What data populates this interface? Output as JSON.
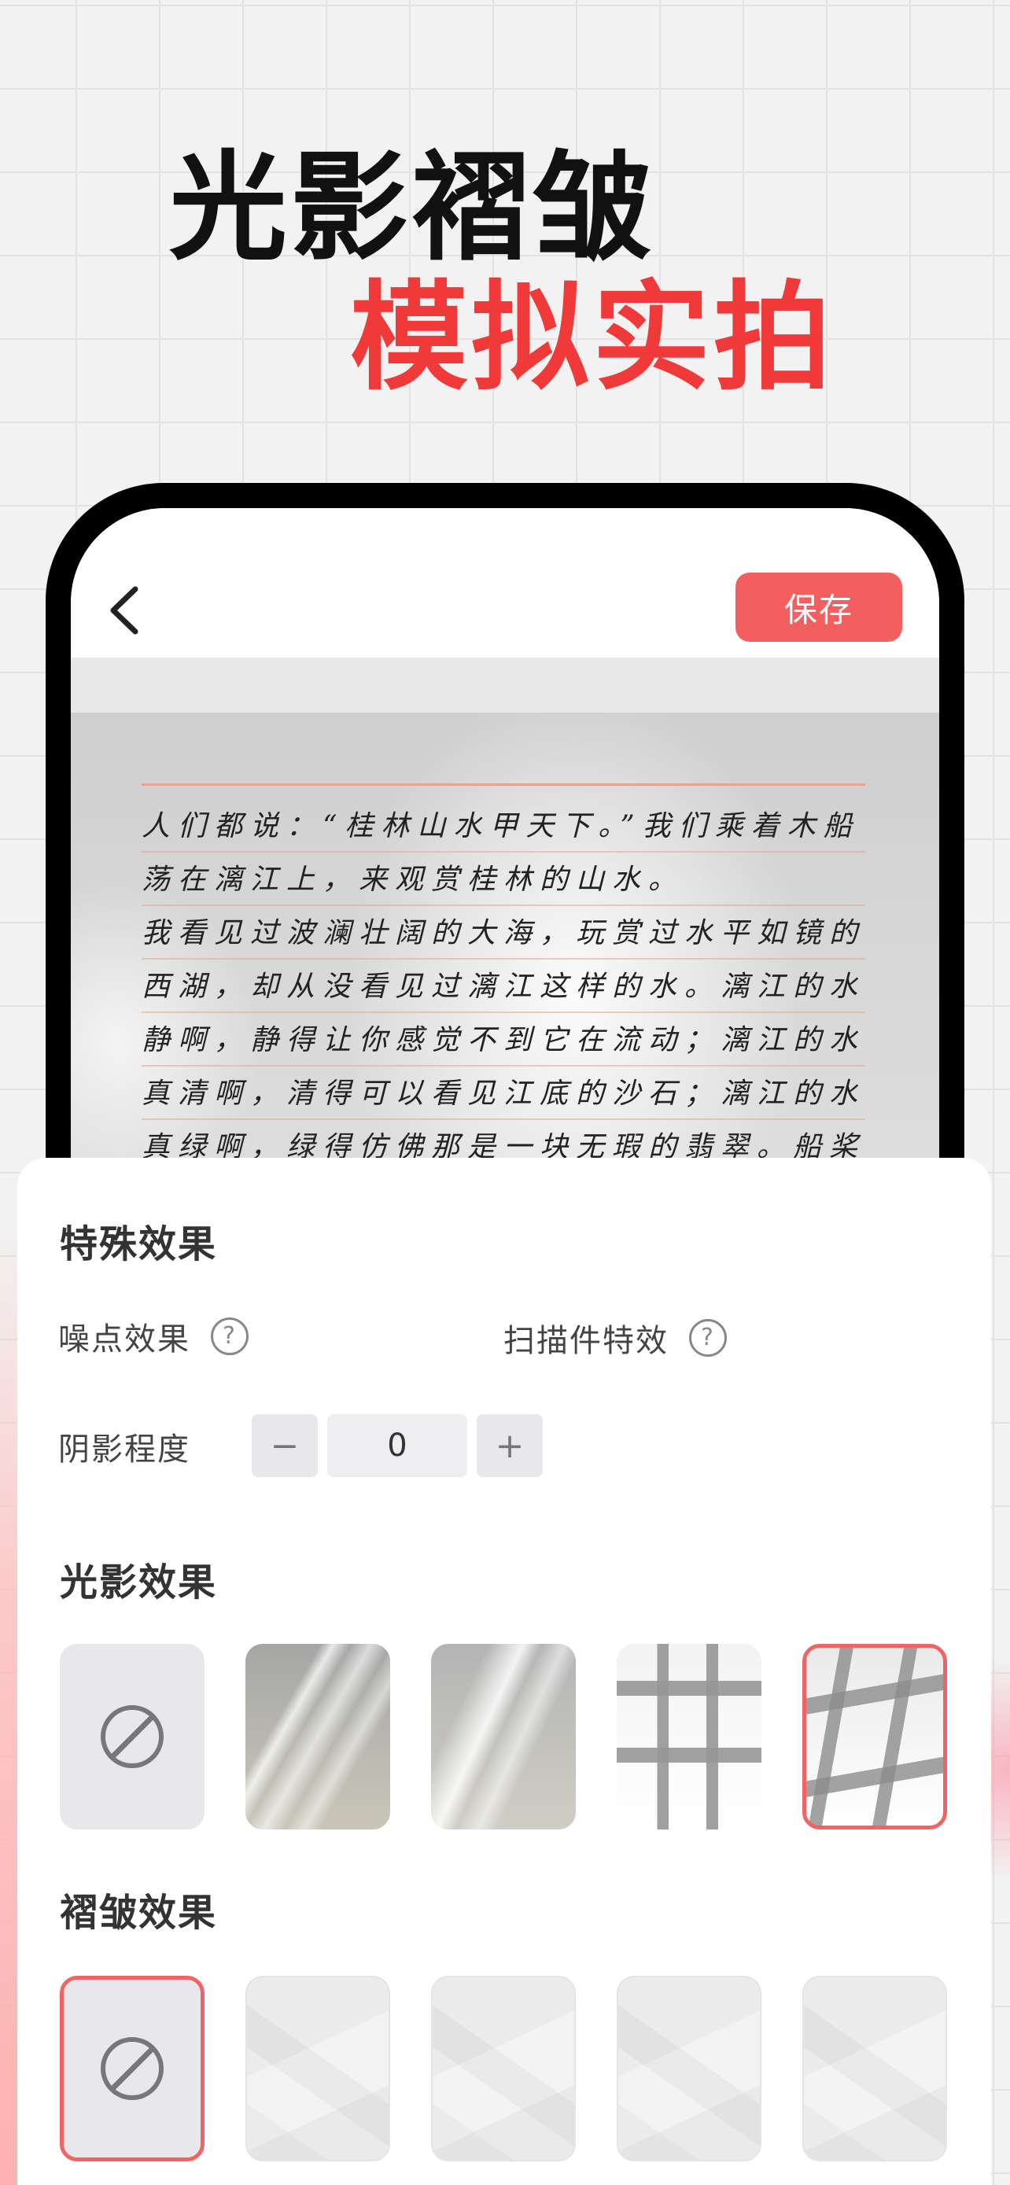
{
  "headline": {
    "line1": "光影褶皱",
    "line2": "模拟实拍"
  },
  "editor": {
    "save_label": "保存",
    "handwriting_lines": [
      "人们都说：“桂林山水甲天下。”我们乘着木船",
      "荡在漓江上，来观赏桂林的山水。",
      "我看见过波澜壮阔的大海，玩赏过水平如镜的",
      "西湖，却从没看见过漓江这样的水。漓江的水真",
      "静啊，静得让你感觉不到它在流动；漓江的水",
      "真清啊，清得可以看见江底的沙石；漓江的水",
      "真绿啊，绿得仿佛那是一块无瑕的翡翠。船桨激"
    ]
  },
  "special_effects": {
    "title": "特殊效果",
    "noise_label": "噪点效果",
    "scan_label": "扫描件特效",
    "help_symbol": "?",
    "shadow_label": "阴影程度",
    "shadow_value": "0",
    "minus_symbol": "−",
    "plus_symbol": "+"
  },
  "light_effects": {
    "title": "光影效果",
    "selected_index": 4
  },
  "crease_effects": {
    "title": "褶皱效果",
    "selected_index": 0
  },
  "colors": {
    "accent": "#f35f5f",
    "headline_red": "#f03a3a"
  }
}
